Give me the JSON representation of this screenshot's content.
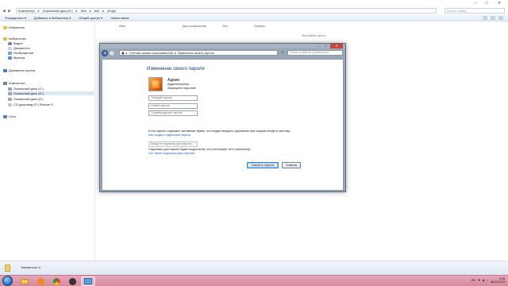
{
  "explorer": {
    "address_crumbs": [
      "Компьютер",
      "Локальный диск (D:)",
      "files",
      "test",
      "empty"
    ],
    "search_placeholder": "Поиск: empty",
    "toolbar": [
      "Упорядочить ▾",
      "Добавить в библиотеку ▾",
      "Общий доступ ▾",
      "Новая папка"
    ],
    "columns": [
      "Имя",
      "Дата изменения",
      "Тип",
      "Размер"
    ],
    "empty_message": "Эта папка пуста.",
    "nav": {
      "favorites": "Избранное",
      "libraries": "Библиотеки",
      "library_items": [
        "Видео",
        "Документы",
        "Изображения",
        "Музыка"
      ],
      "homegroup": "Домашняя группа",
      "computer": "Компьютер",
      "drives": [
        "Локальный диск (C:)",
        "Локальный диск (D:)",
        "Локальный диск (E:)",
        "CD-дисковод (F:) Rescue 5"
      ],
      "network": "Сеть"
    },
    "status": "Элементов: 0"
  },
  "dialog": {
    "address_crumbs": [
      "Учетные записи пользователей",
      "Изменение своего пароля"
    ],
    "search_placeholder": "Поиск в панели управления",
    "heading": "Изменение своего пароля",
    "user": {
      "name": "Админ",
      "role": "Администратор",
      "protection": "Защищено паролем"
    },
    "fields": {
      "current": "Текущий пароль",
      "new": "Новый пароль",
      "confirm": "Подтверждение пароля",
      "hint": "Введите подсказку для пароля"
    },
    "caps_note": "Если пароль содержит заглавные буквы, их следует вводить одинаково при каждом входе в систему.",
    "caps_link": "Как создать надежный пароль",
    "hint_note": "Подсказка для пароля будет видна всем, кто использует этот компьютер.",
    "hint_link": "Что такое подсказка для пароля?",
    "buttons": {
      "change": "Сменить пароль",
      "cancel": "Отмена"
    }
  },
  "taskbar": {
    "language": "EN",
    "time": "9:05",
    "date": "08.04.2013"
  }
}
